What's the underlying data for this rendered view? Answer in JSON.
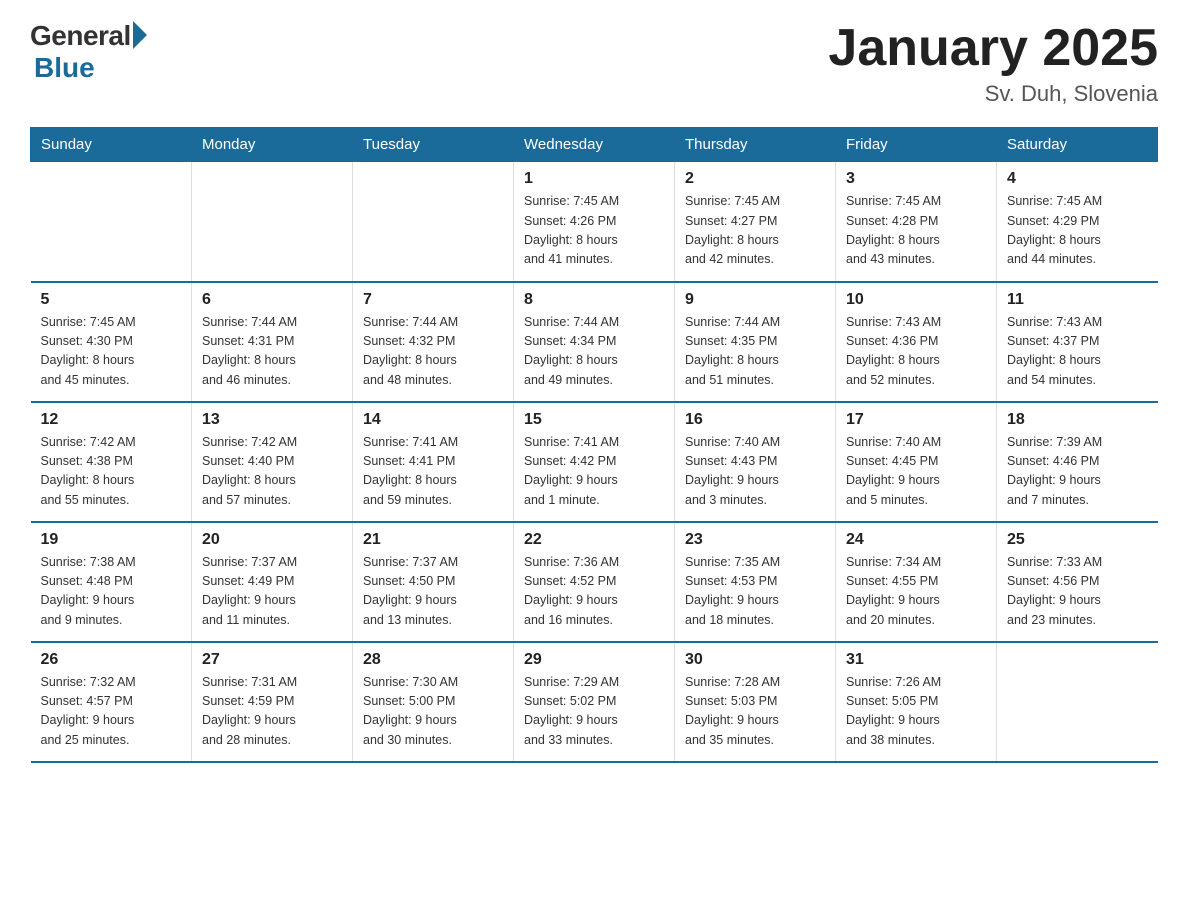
{
  "logo": {
    "general": "General",
    "blue": "Blue"
  },
  "title": "January 2025",
  "location": "Sv. Duh, Slovenia",
  "weekdays": [
    "Sunday",
    "Monday",
    "Tuesday",
    "Wednesday",
    "Thursday",
    "Friday",
    "Saturday"
  ],
  "weeks": [
    [
      {
        "day": "",
        "info": ""
      },
      {
        "day": "",
        "info": ""
      },
      {
        "day": "",
        "info": ""
      },
      {
        "day": "1",
        "info": "Sunrise: 7:45 AM\nSunset: 4:26 PM\nDaylight: 8 hours\nand 41 minutes."
      },
      {
        "day": "2",
        "info": "Sunrise: 7:45 AM\nSunset: 4:27 PM\nDaylight: 8 hours\nand 42 minutes."
      },
      {
        "day": "3",
        "info": "Sunrise: 7:45 AM\nSunset: 4:28 PM\nDaylight: 8 hours\nand 43 minutes."
      },
      {
        "day": "4",
        "info": "Sunrise: 7:45 AM\nSunset: 4:29 PM\nDaylight: 8 hours\nand 44 minutes."
      }
    ],
    [
      {
        "day": "5",
        "info": "Sunrise: 7:45 AM\nSunset: 4:30 PM\nDaylight: 8 hours\nand 45 minutes."
      },
      {
        "day": "6",
        "info": "Sunrise: 7:44 AM\nSunset: 4:31 PM\nDaylight: 8 hours\nand 46 minutes."
      },
      {
        "day": "7",
        "info": "Sunrise: 7:44 AM\nSunset: 4:32 PM\nDaylight: 8 hours\nand 48 minutes."
      },
      {
        "day": "8",
        "info": "Sunrise: 7:44 AM\nSunset: 4:34 PM\nDaylight: 8 hours\nand 49 minutes."
      },
      {
        "day": "9",
        "info": "Sunrise: 7:44 AM\nSunset: 4:35 PM\nDaylight: 8 hours\nand 51 minutes."
      },
      {
        "day": "10",
        "info": "Sunrise: 7:43 AM\nSunset: 4:36 PM\nDaylight: 8 hours\nand 52 minutes."
      },
      {
        "day": "11",
        "info": "Sunrise: 7:43 AM\nSunset: 4:37 PM\nDaylight: 8 hours\nand 54 minutes."
      }
    ],
    [
      {
        "day": "12",
        "info": "Sunrise: 7:42 AM\nSunset: 4:38 PM\nDaylight: 8 hours\nand 55 minutes."
      },
      {
        "day": "13",
        "info": "Sunrise: 7:42 AM\nSunset: 4:40 PM\nDaylight: 8 hours\nand 57 minutes."
      },
      {
        "day": "14",
        "info": "Sunrise: 7:41 AM\nSunset: 4:41 PM\nDaylight: 8 hours\nand 59 minutes."
      },
      {
        "day": "15",
        "info": "Sunrise: 7:41 AM\nSunset: 4:42 PM\nDaylight: 9 hours\nand 1 minute."
      },
      {
        "day": "16",
        "info": "Sunrise: 7:40 AM\nSunset: 4:43 PM\nDaylight: 9 hours\nand 3 minutes."
      },
      {
        "day": "17",
        "info": "Sunrise: 7:40 AM\nSunset: 4:45 PM\nDaylight: 9 hours\nand 5 minutes."
      },
      {
        "day": "18",
        "info": "Sunrise: 7:39 AM\nSunset: 4:46 PM\nDaylight: 9 hours\nand 7 minutes."
      }
    ],
    [
      {
        "day": "19",
        "info": "Sunrise: 7:38 AM\nSunset: 4:48 PM\nDaylight: 9 hours\nand 9 minutes."
      },
      {
        "day": "20",
        "info": "Sunrise: 7:37 AM\nSunset: 4:49 PM\nDaylight: 9 hours\nand 11 minutes."
      },
      {
        "day": "21",
        "info": "Sunrise: 7:37 AM\nSunset: 4:50 PM\nDaylight: 9 hours\nand 13 minutes."
      },
      {
        "day": "22",
        "info": "Sunrise: 7:36 AM\nSunset: 4:52 PM\nDaylight: 9 hours\nand 16 minutes."
      },
      {
        "day": "23",
        "info": "Sunrise: 7:35 AM\nSunset: 4:53 PM\nDaylight: 9 hours\nand 18 minutes."
      },
      {
        "day": "24",
        "info": "Sunrise: 7:34 AM\nSunset: 4:55 PM\nDaylight: 9 hours\nand 20 minutes."
      },
      {
        "day": "25",
        "info": "Sunrise: 7:33 AM\nSunset: 4:56 PM\nDaylight: 9 hours\nand 23 minutes."
      }
    ],
    [
      {
        "day": "26",
        "info": "Sunrise: 7:32 AM\nSunset: 4:57 PM\nDaylight: 9 hours\nand 25 minutes."
      },
      {
        "day": "27",
        "info": "Sunrise: 7:31 AM\nSunset: 4:59 PM\nDaylight: 9 hours\nand 28 minutes."
      },
      {
        "day": "28",
        "info": "Sunrise: 7:30 AM\nSunset: 5:00 PM\nDaylight: 9 hours\nand 30 minutes."
      },
      {
        "day": "29",
        "info": "Sunrise: 7:29 AM\nSunset: 5:02 PM\nDaylight: 9 hours\nand 33 minutes."
      },
      {
        "day": "30",
        "info": "Sunrise: 7:28 AM\nSunset: 5:03 PM\nDaylight: 9 hours\nand 35 minutes."
      },
      {
        "day": "31",
        "info": "Sunrise: 7:26 AM\nSunset: 5:05 PM\nDaylight: 9 hours\nand 38 minutes."
      },
      {
        "day": "",
        "info": ""
      }
    ]
  ]
}
